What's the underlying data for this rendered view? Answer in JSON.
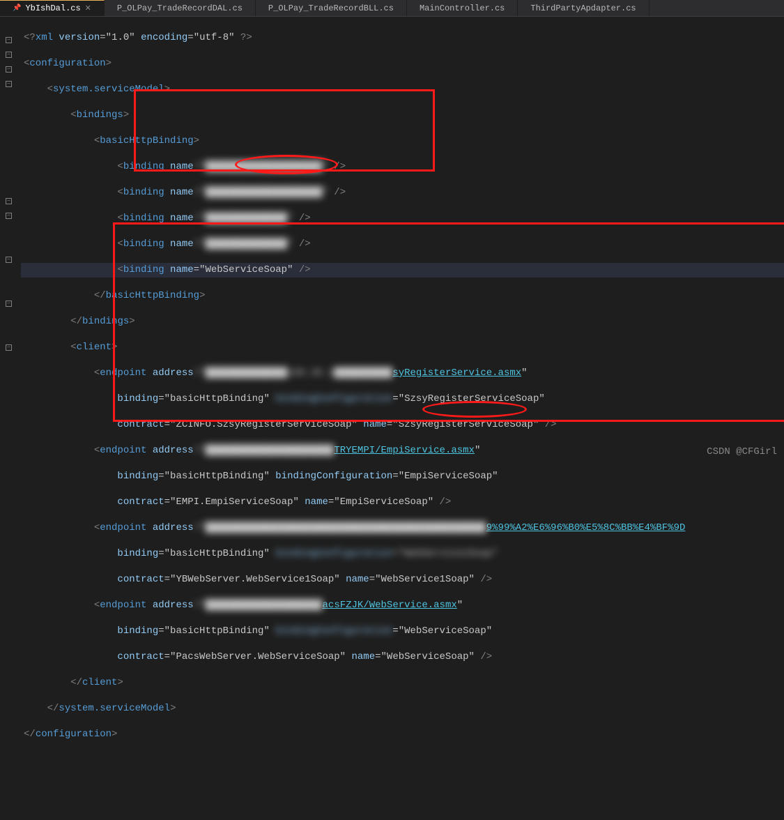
{
  "tabs": [
    {
      "label": "YbIshDal.cs",
      "active": true
    },
    {
      "label": "P_OLPay_TradeRecordDAL.cs",
      "active": false
    },
    {
      "label": "P_OLPay_TradeRecordBLL.cs",
      "active": false
    },
    {
      "label": "MainController.cs",
      "active": false
    },
    {
      "label": "ThirdPartyApdapter.cs",
      "active": false
    }
  ],
  "lines": {
    "l1_pre": "<?",
    "l1_tag": "xml",
    "l1_a1": " version",
    "l1_v1": "=\"1.0\"",
    "l1_a2": " encoding",
    "l1_v2": "=\"utf-8\"",
    "l1_post": " ?>",
    "l2": "configuration",
    "l3": "system.serviceModel",
    "l4": "bindings",
    "l5": "basicHttpBinding",
    "b_tag": "binding",
    "b_attr": " name",
    "b1_v": "=\"████████████████████\"",
    "b1_post": " />",
    "b2_v": "=\"████████████████████\"",
    "b2_post": " />",
    "b3_v": "=\"██████████████\"",
    "b3_post": " />",
    "b4_v": "=\"██████████████\"",
    "b4_post": " />",
    "b5_v": "=\"WebServiceSoap\"",
    "b5_post": " />",
    "l11_close": "basicHttpBinding",
    "l12_close": "bindings",
    "l13": "client",
    "ep_tag": "endpoint",
    "addr_attr": " address",
    "ep1_addr_v": "=\"██████████████168.26.1██████████",
    "ep1_url": "syRegisterService.asmx",
    "ep1_addr_end": "\"",
    "bind_attr": "binding",
    "bind_v": "=\"basicHttpBinding\"",
    "bc_attr": " bindingConfiguration",
    "ep1_bc_v": "=\"SzsyRegisterServiceSoap\"",
    "con_attr": "contract",
    "ep1_con_v": "=\"ZCINFO.SzsyRegisterServiceSoap\"",
    "name_attr": " name",
    "ep1_name_v": "=\"SzsyRegisterServiceSoap\"",
    "ep2_addr_v": "=\"██████████████████████",
    "ep2_url": "TRYEMPI/EmpiService.asmx",
    "ep2_addr_end": "\"",
    "ep2_bc_v": "=\"EmpiServiceSoap\"",
    "ep2_con_v": "=\"EMPI.EmpiServiceSoap\"",
    "ep2_name_v": "=\"EmpiServiceSoap\"",
    "ep3_addr_v": "=\"████████████████████████████████████████████████",
    "ep3_url": "9%99%A2%E6%96%B0%E5%8C%BB%E4%BF%9D",
    "ep3_addr_end": "",
    "ep3_bc_v": "=\"WebService1Soap\"",
    "ep3_con_v": "=\"YBWebServer.WebService1Soap\"",
    "ep3_name_v": "=\"WebService1Soap\"",
    "ep4_addr_v": "=\"████████████████████",
    "ep4_url": "acsFZJK/WebService.asmx",
    "ep4_addr_end": "\"",
    "ep4_bc_v": "=\"WebServiceSoap\"",
    "ep4_con_v": "=\"PacsWebServer.WebServiceSoap\"",
    "ep4_name_v": "=\"WebServiceSoap\"",
    "l26_close": "client",
    "l27_close": "system.serviceModel",
    "l28_close": "configuration",
    "slash_close": " />",
    "watermark": "CSDN @CFGirl"
  }
}
